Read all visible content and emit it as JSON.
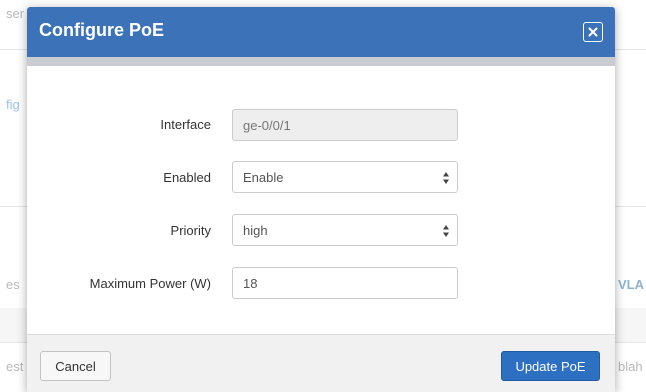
{
  "background": {
    "row1_fragment": "ser",
    "link_fragment": "fig",
    "col_left_fragment": "es",
    "col_right_fragment": "VLA",
    "row_bottom_left_fragment": "est",
    "row_bottom_right_fragment": "blah"
  },
  "dialog": {
    "title": "Configure PoE",
    "close_icon": "close-icon",
    "header_color": "#3c72b8"
  },
  "form": {
    "interface": {
      "label": "Interface",
      "value": "ge-0/0/1"
    },
    "enabled": {
      "label": "Enabled",
      "selected": "Enable"
    },
    "priority": {
      "label": "Priority",
      "selected": "high"
    },
    "max_power": {
      "label": "Maximum Power (W)",
      "value": "18"
    }
  },
  "footer": {
    "cancel_label": "Cancel",
    "update_label": "Update PoE",
    "update_color": "#2d6fc1"
  }
}
